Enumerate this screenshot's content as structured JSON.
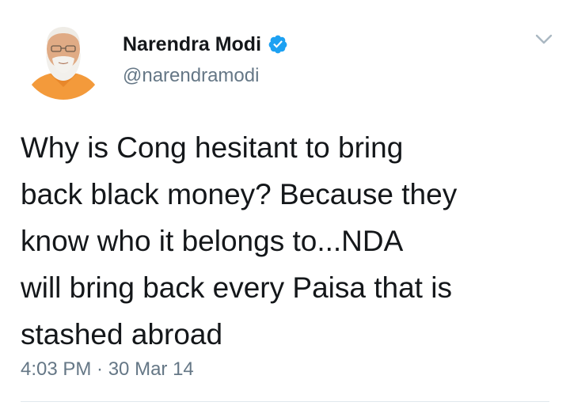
{
  "colors": {
    "text_primary": "#14171a",
    "text_secondary": "#657786",
    "verified_blue": "#1da1f2",
    "divider": "#e1e8ed"
  },
  "tweet": {
    "author": {
      "display_name": "Narendra Modi",
      "handle": "@narendramodi",
      "verified": true,
      "verified_icon": "verified-badge-icon",
      "avatar": "avatar-photo"
    },
    "menu_icon": "chevron-down-icon",
    "text": "Why is Cong hesitant to bring\nback black money? Because they\nknow who it belongs to...NDA\nwill bring back every Paisa that is\nstashed abroad",
    "timestamp": "4:03 PM · 30 Mar 14"
  }
}
